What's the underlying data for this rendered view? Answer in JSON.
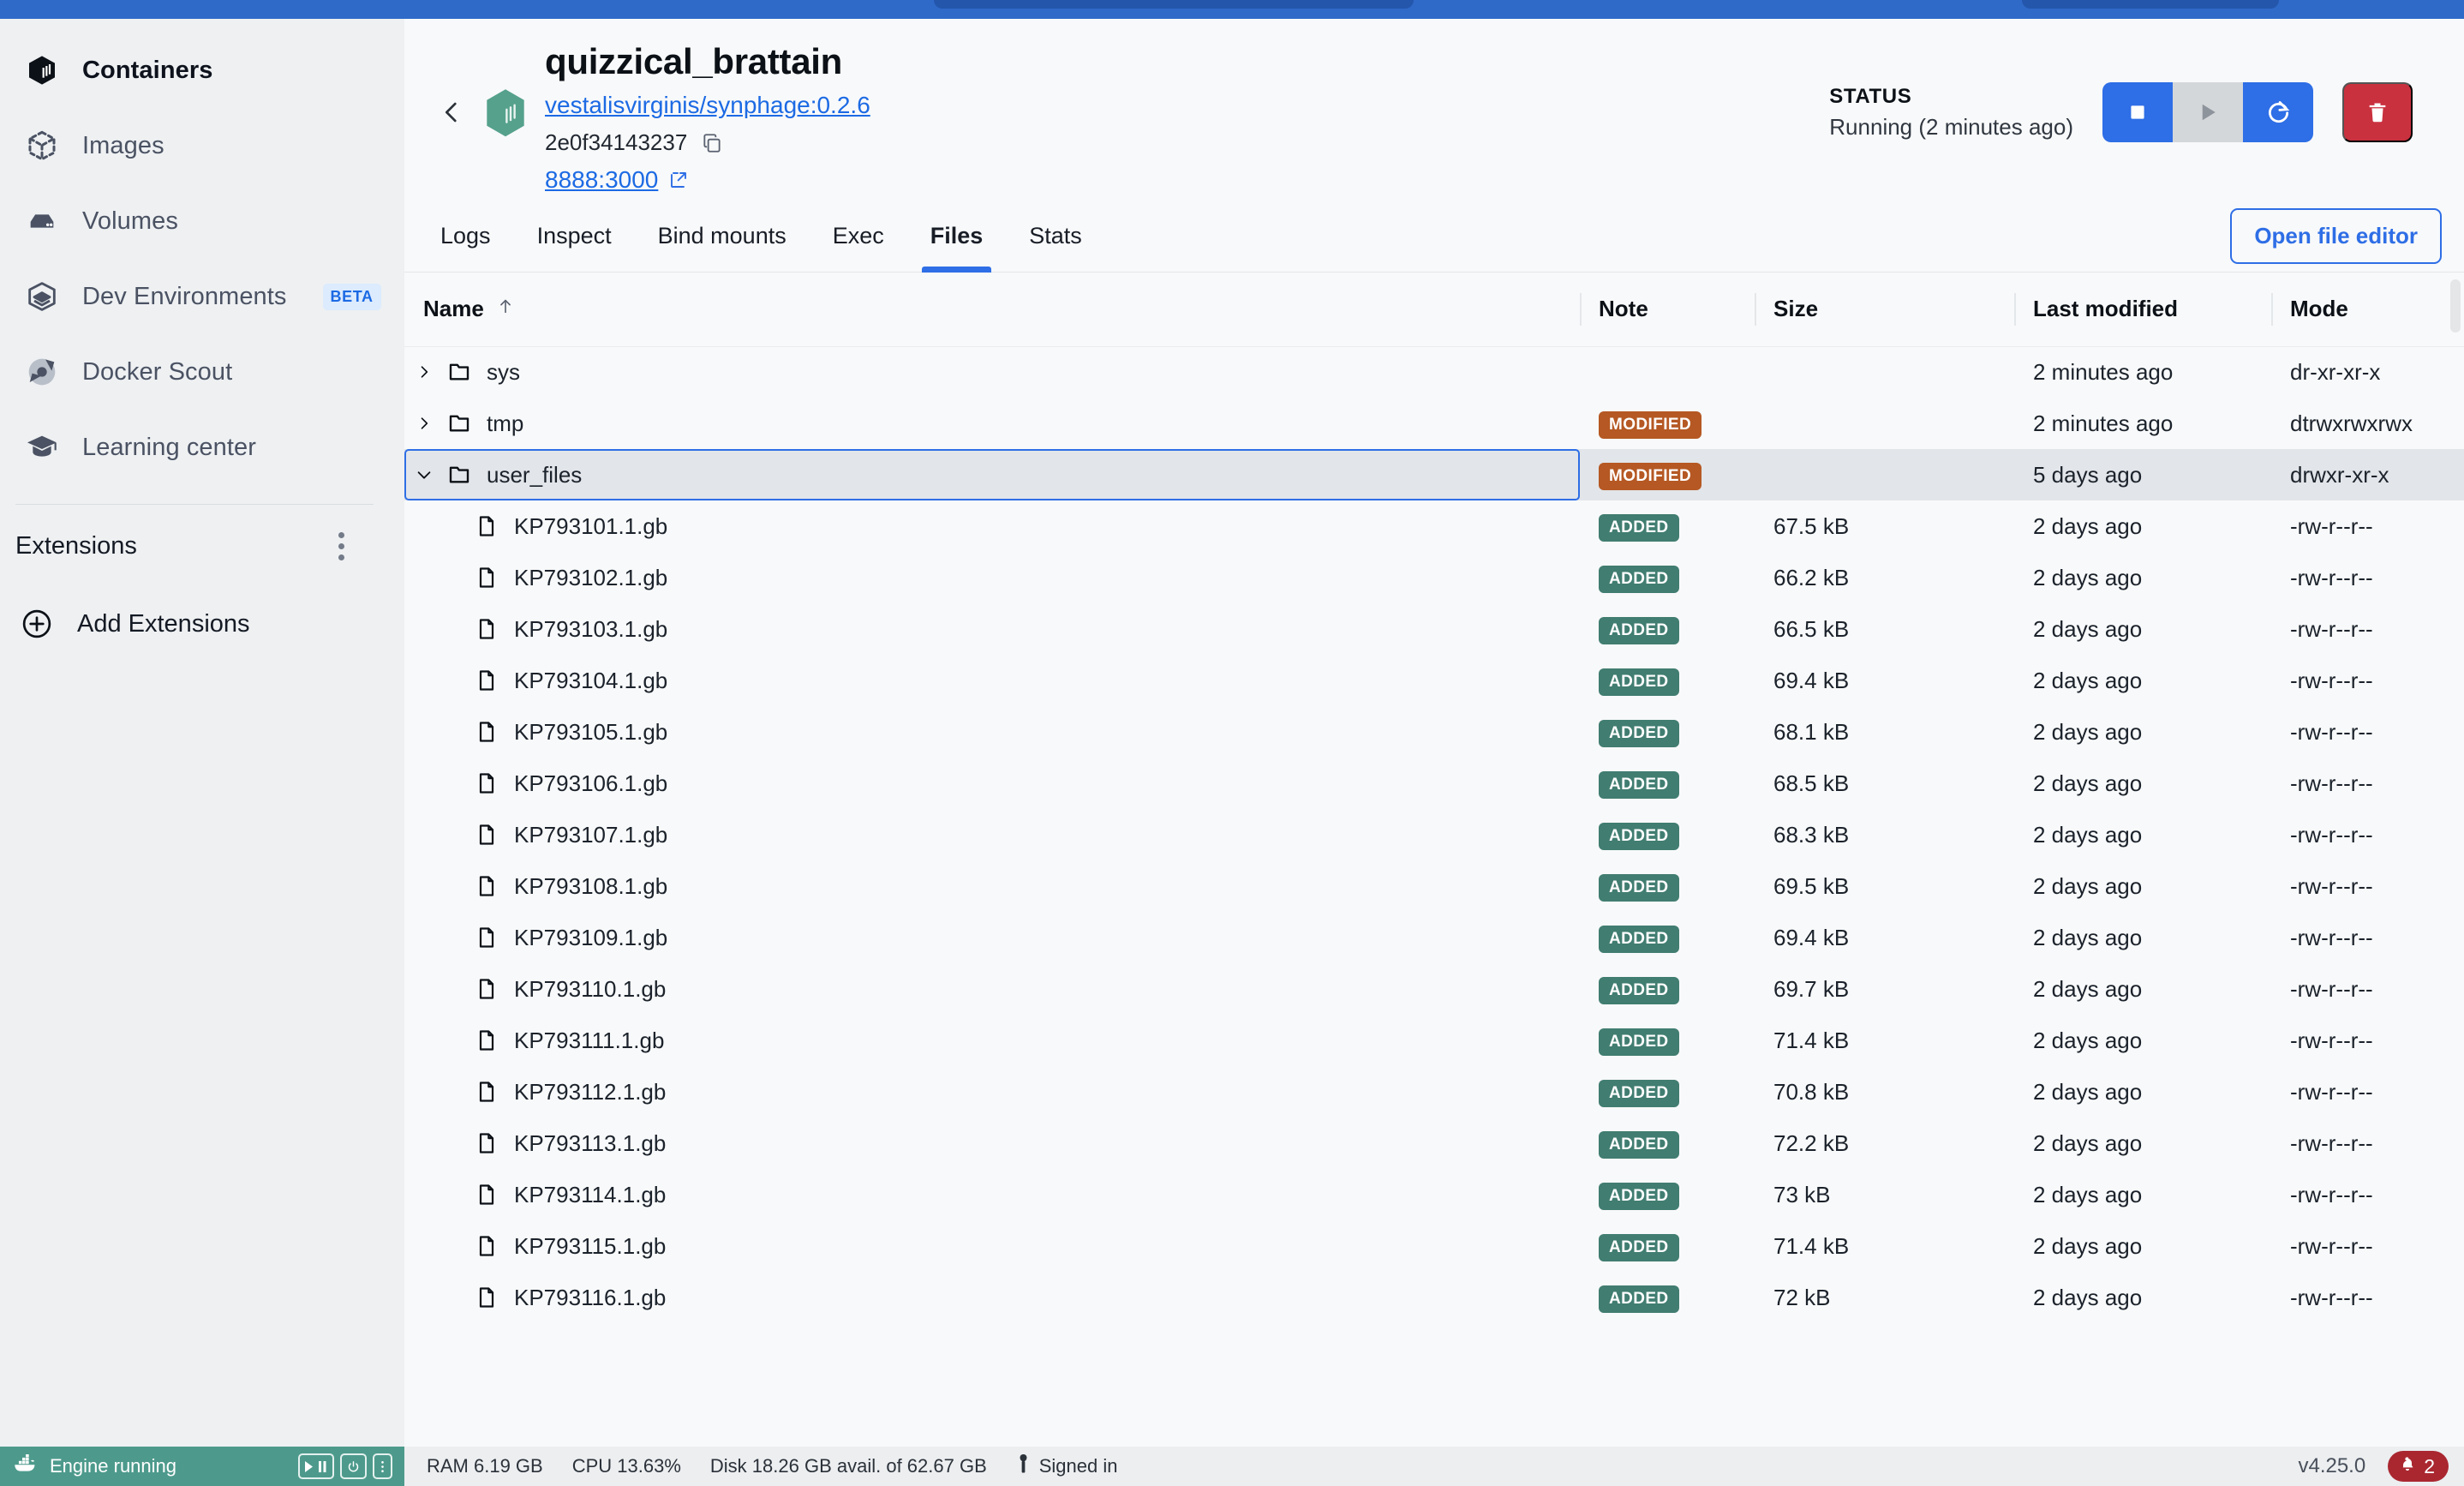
{
  "sidebar": {
    "items": [
      {
        "label": "Containers",
        "icon": "container-icon",
        "active": true
      },
      {
        "label": "Images",
        "icon": "images-icon",
        "active": false
      },
      {
        "label": "Volumes",
        "icon": "volumes-icon",
        "active": false
      },
      {
        "label": "Dev Environments",
        "icon": "dev-environments-icon",
        "badge": "BETA",
        "active": false
      },
      {
        "label": "Docker Scout",
        "icon": "docker-scout-icon",
        "active": false
      },
      {
        "label": "Learning center",
        "icon": "learning-center-icon",
        "active": false
      }
    ],
    "extensions_label": "Extensions",
    "add_extensions_label": "Add Extensions"
  },
  "container": {
    "name": "quizzical_brattain",
    "image": "vestalisvirginis/synphage:0.2.6",
    "id": "2e0f34143237",
    "port": "8888:3000",
    "status_label": "STATUS",
    "status_value": "Running (2 minutes ago)",
    "actions": {
      "stop": "stop-button",
      "start": "start-button",
      "restart": "restart-button",
      "delete": "delete-button"
    }
  },
  "tabs": [
    {
      "label": "Logs",
      "active": false
    },
    {
      "label": "Inspect",
      "active": false
    },
    {
      "label": "Bind mounts",
      "active": false
    },
    {
      "label": "Exec",
      "active": false
    },
    {
      "label": "Files",
      "active": true
    },
    {
      "label": "Stats",
      "active": false
    }
  ],
  "open_file_editor_label": "Open file editor",
  "table": {
    "columns": [
      "Name",
      "Note",
      "Size",
      "Last modified",
      "Mode"
    ],
    "sort": {
      "column": "Name",
      "direction": "asc"
    },
    "rows": [
      {
        "name": "sys",
        "type": "folder",
        "depth": 0,
        "expanded": false,
        "selected": false,
        "note": "",
        "size": "",
        "modified": "2 minutes ago",
        "mode": "dr-xr-xr-x"
      },
      {
        "name": "tmp",
        "type": "folder",
        "depth": 0,
        "expanded": false,
        "selected": false,
        "note": "MODIFIED",
        "size": "",
        "modified": "2 minutes ago",
        "mode": "dtrwxrwxrwx"
      },
      {
        "name": "user_files",
        "type": "folder",
        "depth": 0,
        "expanded": true,
        "selected": true,
        "note": "MODIFIED",
        "size": "",
        "modified": "5 days ago",
        "mode": "drwxr-xr-x"
      },
      {
        "name": "KP793101.1.gb",
        "type": "file",
        "depth": 1,
        "expanded": false,
        "selected": false,
        "note": "ADDED",
        "size": "67.5 kB",
        "modified": "2 days ago",
        "mode": "-rw-r--r--"
      },
      {
        "name": "KP793102.1.gb",
        "type": "file",
        "depth": 1,
        "expanded": false,
        "selected": false,
        "note": "ADDED",
        "size": "66.2 kB",
        "modified": "2 days ago",
        "mode": "-rw-r--r--"
      },
      {
        "name": "KP793103.1.gb",
        "type": "file",
        "depth": 1,
        "expanded": false,
        "selected": false,
        "note": "ADDED",
        "size": "66.5 kB",
        "modified": "2 days ago",
        "mode": "-rw-r--r--"
      },
      {
        "name": "KP793104.1.gb",
        "type": "file",
        "depth": 1,
        "expanded": false,
        "selected": false,
        "note": "ADDED",
        "size": "69.4 kB",
        "modified": "2 days ago",
        "mode": "-rw-r--r--"
      },
      {
        "name": "KP793105.1.gb",
        "type": "file",
        "depth": 1,
        "expanded": false,
        "selected": false,
        "note": "ADDED",
        "size": "68.1 kB",
        "modified": "2 days ago",
        "mode": "-rw-r--r--"
      },
      {
        "name": "KP793106.1.gb",
        "type": "file",
        "depth": 1,
        "expanded": false,
        "selected": false,
        "note": "ADDED",
        "size": "68.5 kB",
        "modified": "2 days ago",
        "mode": "-rw-r--r--"
      },
      {
        "name": "KP793107.1.gb",
        "type": "file",
        "depth": 1,
        "expanded": false,
        "selected": false,
        "note": "ADDED",
        "size": "68.3 kB",
        "modified": "2 days ago",
        "mode": "-rw-r--r--"
      },
      {
        "name": "KP793108.1.gb",
        "type": "file",
        "depth": 1,
        "expanded": false,
        "selected": false,
        "note": "ADDED",
        "size": "69.5 kB",
        "modified": "2 days ago",
        "mode": "-rw-r--r--"
      },
      {
        "name": "KP793109.1.gb",
        "type": "file",
        "depth": 1,
        "expanded": false,
        "selected": false,
        "note": "ADDED",
        "size": "69.4 kB",
        "modified": "2 days ago",
        "mode": "-rw-r--r--"
      },
      {
        "name": "KP793110.1.gb",
        "type": "file",
        "depth": 1,
        "expanded": false,
        "selected": false,
        "note": "ADDED",
        "size": "69.7 kB",
        "modified": "2 days ago",
        "mode": "-rw-r--r--"
      },
      {
        "name": "KP793111.1.gb",
        "type": "file",
        "depth": 1,
        "expanded": false,
        "selected": false,
        "note": "ADDED",
        "size": "71.4 kB",
        "modified": "2 days ago",
        "mode": "-rw-r--r--"
      },
      {
        "name": "KP793112.1.gb",
        "type": "file",
        "depth": 1,
        "expanded": false,
        "selected": false,
        "note": "ADDED",
        "size": "70.8 kB",
        "modified": "2 days ago",
        "mode": "-rw-r--r--"
      },
      {
        "name": "KP793113.1.gb",
        "type": "file",
        "depth": 1,
        "expanded": false,
        "selected": false,
        "note": "ADDED",
        "size": "72.2 kB",
        "modified": "2 days ago",
        "mode": "-rw-r--r--"
      },
      {
        "name": "KP793114.1.gb",
        "type": "file",
        "depth": 1,
        "expanded": false,
        "selected": false,
        "note": "ADDED",
        "size": "73 kB",
        "modified": "2 days ago",
        "mode": "-rw-r--r--"
      },
      {
        "name": "KP793115.1.gb",
        "type": "file",
        "depth": 1,
        "expanded": false,
        "selected": false,
        "note": "ADDED",
        "size": "71.4 kB",
        "modified": "2 days ago",
        "mode": "-rw-r--r--"
      },
      {
        "name": "KP793116.1.gb",
        "type": "file",
        "depth": 1,
        "expanded": false,
        "selected": false,
        "note": "ADDED",
        "size": "72 kB",
        "modified": "2 days ago",
        "mode": "-rw-r--r--"
      }
    ]
  },
  "statusbar": {
    "engine": "Engine running",
    "ram": "RAM 6.19 GB",
    "cpu": "CPU 13.63%",
    "disk": "Disk 18.26 GB avail. of 62.67 GB",
    "account": "Signed in",
    "version": "v4.25.0",
    "notifications": "2"
  },
  "colors": {
    "accent_blue": "#2e6ee6",
    "danger_red": "#c9313e",
    "badge_added": "#417d71",
    "badge_modified": "#b55823",
    "engine_green": "#4d9a8c",
    "titlebar_blue": "#2f6ac9"
  }
}
